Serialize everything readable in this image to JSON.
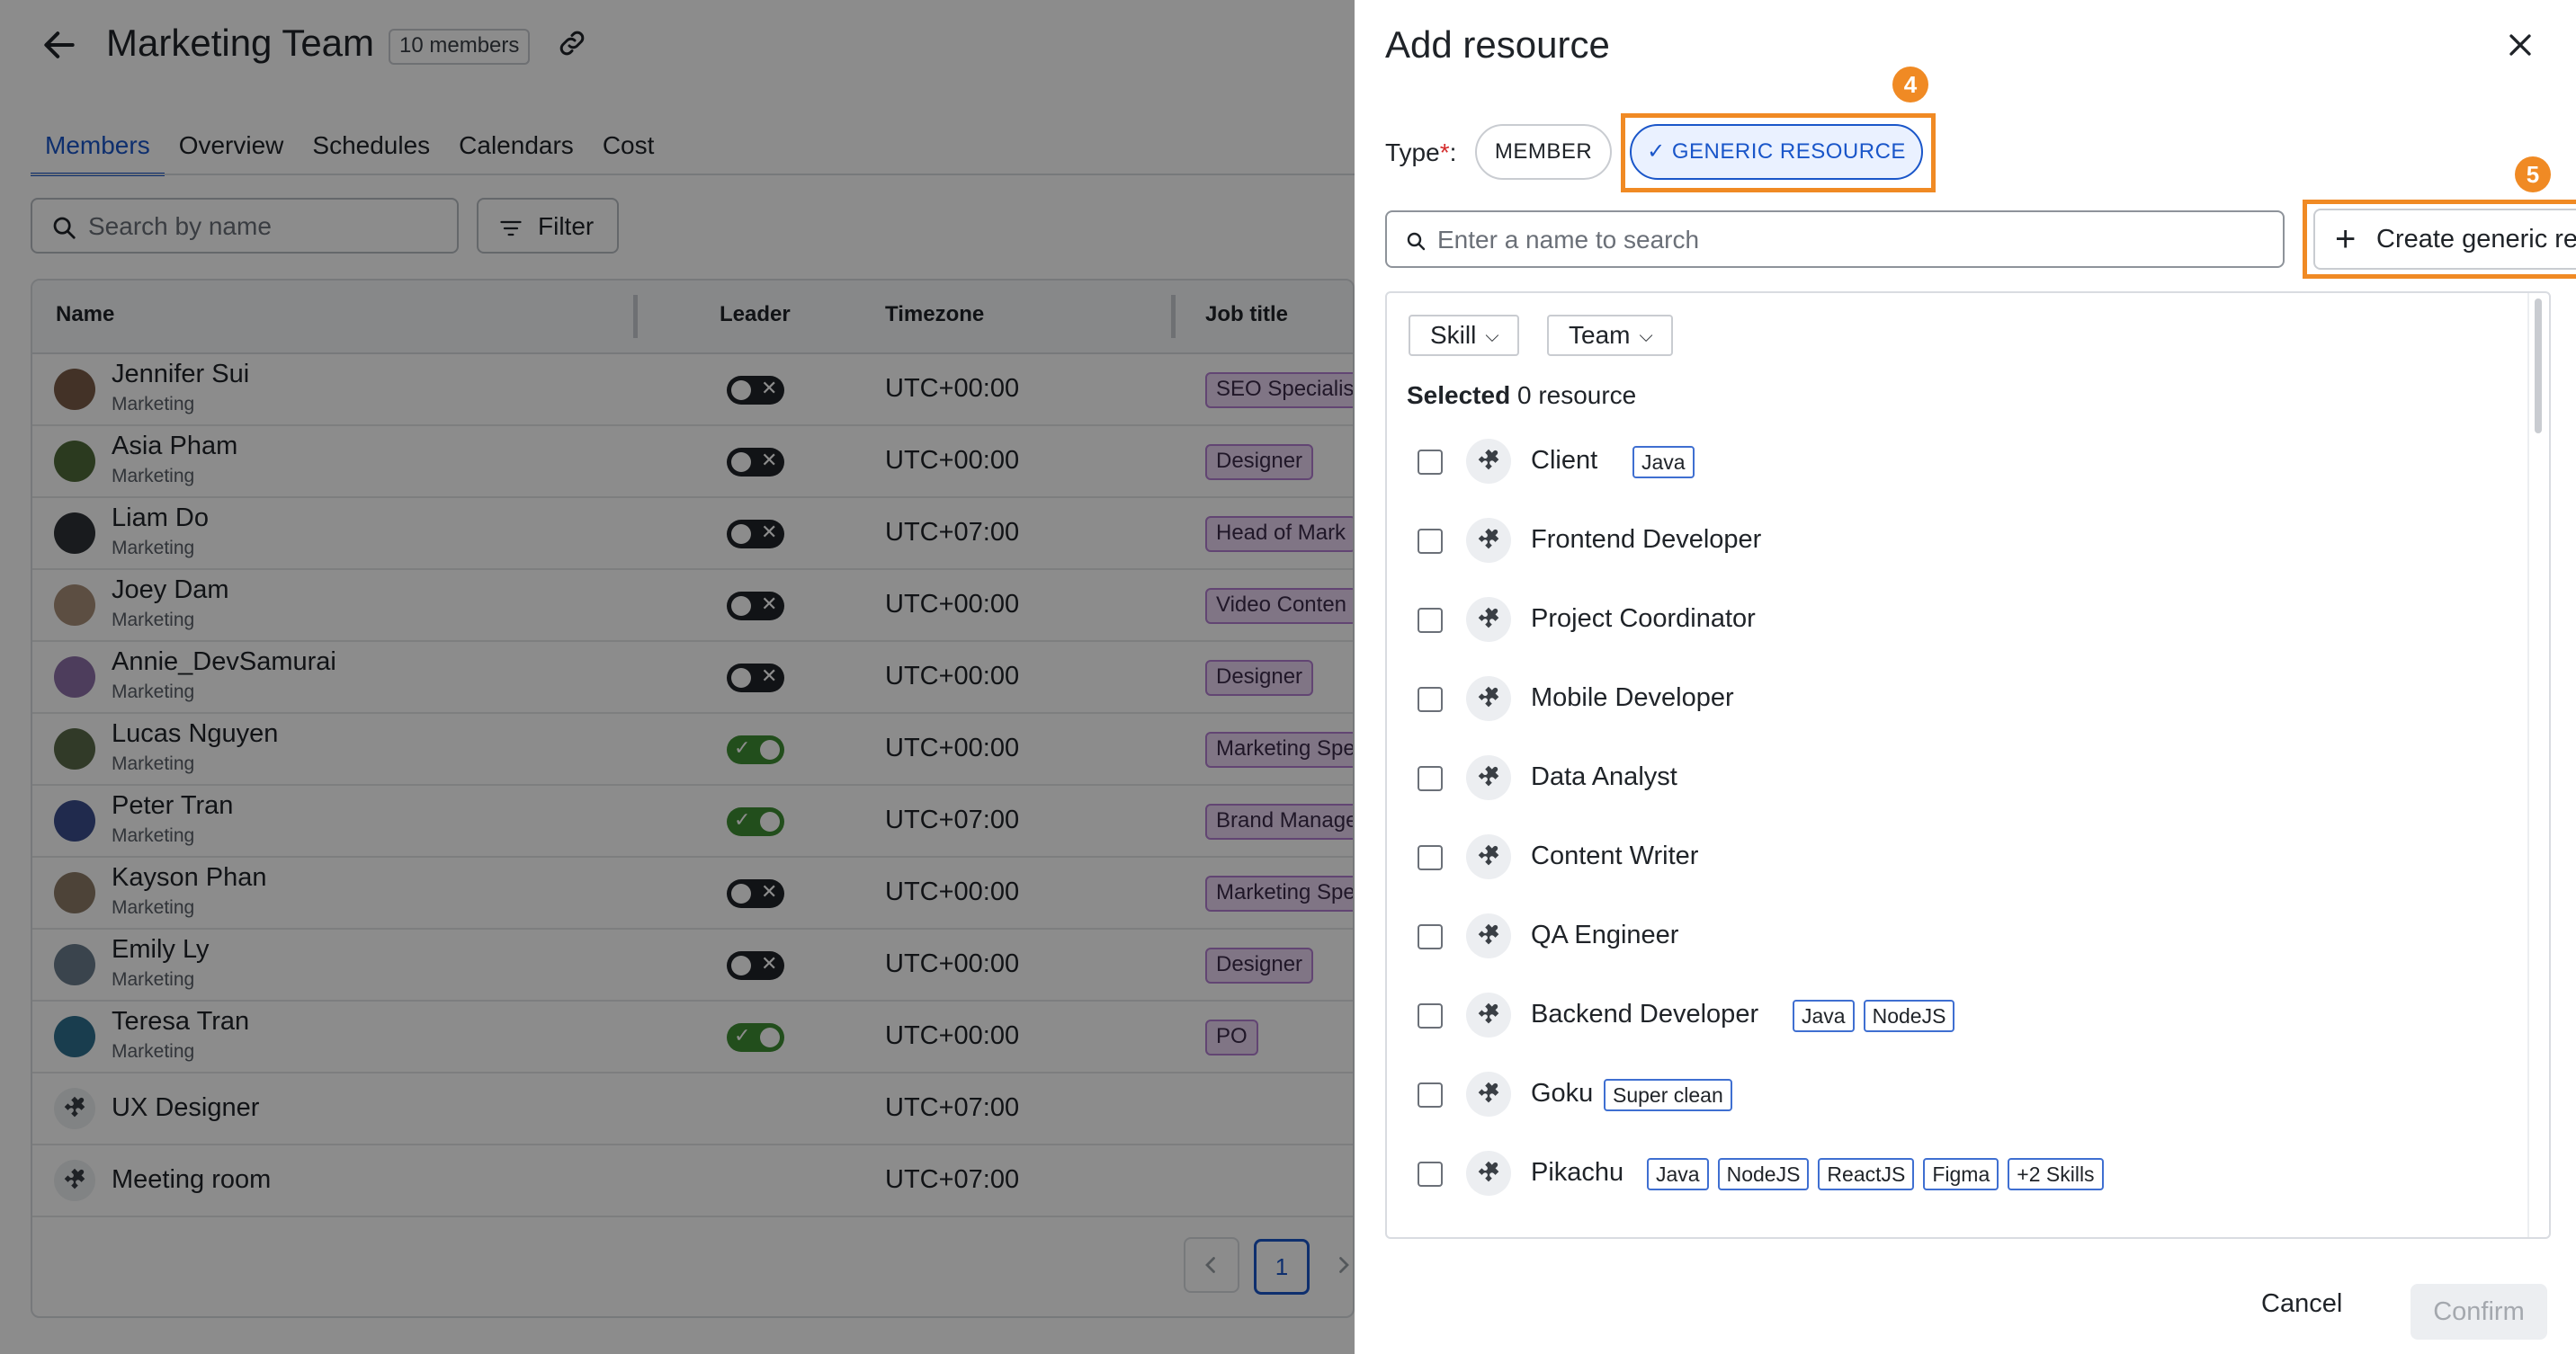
{
  "team": {
    "title": "Marketing Team",
    "members_badge": "10 members"
  },
  "tabs": [
    "Members",
    "Overview",
    "Schedules",
    "Calendars",
    "Cost"
  ],
  "toolbar": {
    "search_placeholder": "Search by name",
    "filter_label": "Filter"
  },
  "table": {
    "headers": {
      "name": "Name",
      "leader": "Leader",
      "timezone": "Timezone",
      "job": "Job title"
    },
    "rows": [
      {
        "name": "Jennifer Sui",
        "dept": "Marketing",
        "leader": false,
        "tz": "UTC+00:00",
        "job": "SEO Specialis",
        "avatar": "#7a5c48"
      },
      {
        "name": "Asia Pham",
        "dept": "Marketing",
        "leader": false,
        "tz": "UTC+00:00",
        "job": "Designer",
        "avatar": "#4f6b3a"
      },
      {
        "name": "Liam Do",
        "dept": "Marketing",
        "leader": false,
        "tz": "UTC+07:00",
        "job": "Head of Mark",
        "avatar": "#2f3237"
      },
      {
        "name": "Joey Dam",
        "dept": "Marketing",
        "leader": false,
        "tz": "UTC+00:00",
        "job": "Video Conten",
        "avatar": "#a88f78"
      },
      {
        "name": "Annie_DevSamurai",
        "dept": "Marketing",
        "leader": false,
        "tz": "UTC+00:00",
        "job": "Designer",
        "avatar": "#8d6fa8"
      },
      {
        "name": "Lucas Nguyen",
        "dept": "Marketing",
        "leader": true,
        "tz": "UTC+00:00",
        "job": "Marketing Spe",
        "avatar": "#5a6b4a"
      },
      {
        "name": "Peter Tran",
        "dept": "Marketing",
        "leader": true,
        "tz": "UTC+07:00",
        "job": "Brand Manage",
        "avatar": "#3b4e8c"
      },
      {
        "name": "Kayson Phan",
        "dept": "Marketing",
        "leader": false,
        "tz": "UTC+00:00",
        "job": "Marketing Spe",
        "avatar": "#8c7a66"
      },
      {
        "name": "Emily Ly",
        "dept": "Marketing",
        "leader": false,
        "tz": "UTC+00:00",
        "job": "Designer",
        "avatar": "#6a7c8c"
      },
      {
        "name": "Teresa Tran",
        "dept": "Marketing",
        "leader": true,
        "tz": "UTC+00:00",
        "job": "PO",
        "avatar": "#2e6f8e"
      }
    ],
    "generic_rows": [
      {
        "name": "UX Designer",
        "tz": "UTC+07:00"
      },
      {
        "name": "Meeting room",
        "tz": "UTC+07:00"
      }
    ],
    "page": "1"
  },
  "drawer": {
    "title": "Add resource",
    "type_label": "Type",
    "type_required": "*",
    "type_colon": ":",
    "type_member": "MEMBER",
    "type_generic": "✓ GENERIC RESOURCE",
    "step4": "4",
    "step5": "5",
    "search_placeholder": "Enter a name to search",
    "create_label": "Create generic resource",
    "filters": {
      "skill": "Skill",
      "team": "Team"
    },
    "selected_prefix": "Selected",
    "selected_count": "0",
    "selected_suffix": "resource",
    "items": [
      {
        "name": "Client",
        "skills": [
          "Java"
        ]
      },
      {
        "name": "Frontend Developer",
        "skills": []
      },
      {
        "name": "Project Coordinator",
        "skills": []
      },
      {
        "name": "Mobile Developer",
        "skills": []
      },
      {
        "name": "Data Analyst",
        "skills": []
      },
      {
        "name": "Content Writer",
        "skills": []
      },
      {
        "name": "QA Engineer",
        "skills": []
      },
      {
        "name": "Backend Developer",
        "skills": [
          "Java",
          "NodeJS"
        ]
      },
      {
        "name": "Goku",
        "skills": [
          "Super clean"
        ]
      },
      {
        "name": "Pikachu",
        "skills": [
          "Java",
          "NodeJS",
          "ReactJS",
          "Figma",
          "+2 Skills"
        ]
      }
    ],
    "cancel_label": "Cancel",
    "confirm_label": "Confirm"
  },
  "colors": {
    "accent": "#1a56c9",
    "highlight": "#f08a24",
    "toggle_on": "#3f8f33",
    "job_badge": "#e9d6f3"
  }
}
